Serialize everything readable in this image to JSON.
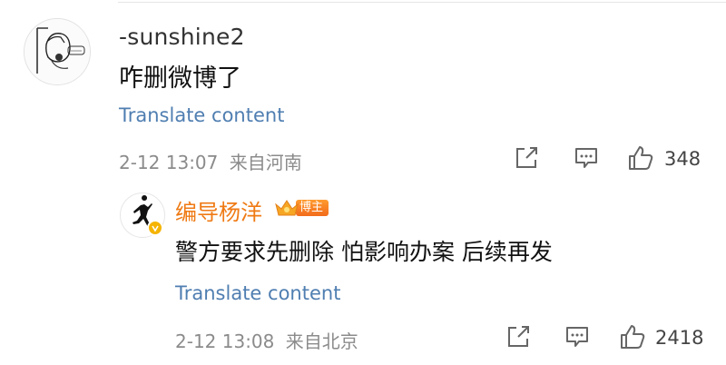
{
  "comment": {
    "username": "-sunshine2",
    "text": "咋删微博了",
    "translate_label": "Translate content",
    "timestamp": "2-12 13:07",
    "location": "来自河南",
    "like_count": "348"
  },
  "reply": {
    "username": "编导杨洋",
    "badge_label": "博主",
    "text": "警方要求先删除 怕影响办案 后续再发",
    "translate_label": "Translate content",
    "timestamp": "2-12 13:08",
    "location": "来自北京",
    "like_count": "2418"
  },
  "icons": {
    "share": "share-icon",
    "comment": "comment-icon",
    "like": "thumbs-up-icon",
    "verified": "verified-badge-icon",
    "crown": "crown-icon"
  },
  "colors": {
    "link": "#4f7eb1",
    "username_highlight": "#ef7a14",
    "meta": "#8b8b8b",
    "verified": "#f5b400"
  }
}
